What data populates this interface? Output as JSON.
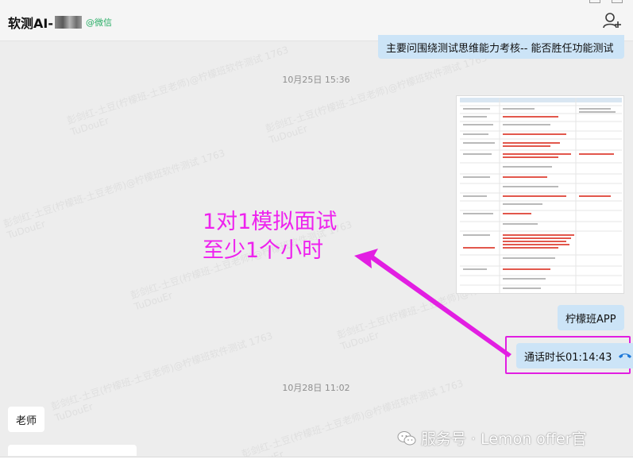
{
  "header": {
    "chat_name": "软测AI-",
    "wechat_suffix": "@微信"
  },
  "messages": [
    {
      "id": "m1",
      "text": "主要问围绕测试思维能力考核-- 能否胜任功能测试"
    },
    {
      "id": "ts1",
      "text": "10月25日 15:36"
    },
    {
      "id": "m2",
      "text": "柠檬班APP"
    },
    {
      "id": "m3",
      "call_label": "通话时长01:14:43"
    },
    {
      "id": "ts2",
      "text": "10月28日 11:02"
    },
    {
      "id": "m4",
      "text": "老师"
    }
  ],
  "annotation": {
    "line1": "1对1模拟面试",
    "line2": "至少1个小时"
  },
  "watermark": {
    "line1": "彭剑红-土豆(柠檬班-土豆老师)@柠檬班软件测试 1763",
    "line2": "TuDouEr"
  },
  "brand": {
    "text": "服务号 · Lemon offer官"
  },
  "colors": {
    "annotation": "#ee22ee",
    "bubble_blue": "#cce4f7",
    "call_icon": "#1e78d8",
    "wechat_tag": "#2aae67"
  }
}
